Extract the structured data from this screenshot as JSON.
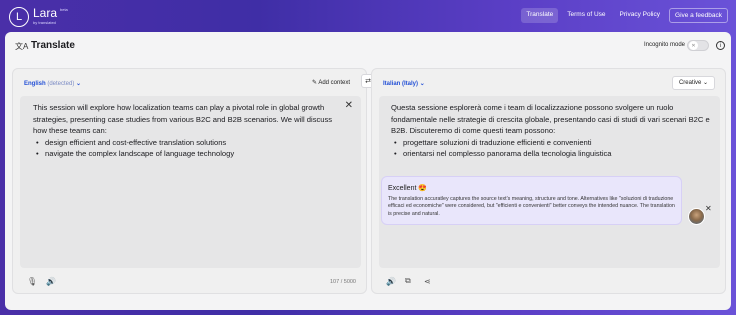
{
  "app": {
    "logo_letter": "L",
    "name": "Lara",
    "beta": "beta",
    "by": "by translated"
  },
  "nav": {
    "translate": "Translate",
    "terms": "Terms of Use",
    "privacy": "Privacy Policy",
    "feedback": "Give a feedback"
  },
  "header": {
    "title": "Translate",
    "incognito_label": "Incognito mode",
    "incognito_enabled": false
  },
  "source": {
    "language": "English",
    "detected": "(detected)",
    "add_context": "Add context",
    "intro": "This session will explore how localization teams can play a pivotal role in global growth strategies, presenting case studies from various B2C and B2B scenarios. We will discuss how these teams can:",
    "bullets": [
      "design efficient and cost-effective translation solutions",
      "navigate the complex landscape of language technology"
    ],
    "char_count": "107 / 5000"
  },
  "target": {
    "language": "Italian (Italy)",
    "style": "Creative",
    "intro": "Questa sessione esplorerà come i team di localizzazione possono svolgere un ruolo fondamentale nelle strategie di crescita globale, presentando casi di studi di vari scenari B2C e B2B. Discuteremo di come questi team possono:",
    "bullets": [
      "progettare soluzioni di traduzione efficienti e convenienti",
      "orientarsi nel complesso panorama della tecnologia linguistica"
    ]
  },
  "quality": {
    "title": "Excellent",
    "emoji": "😍",
    "text": "The translation accuratley captures the source text's meaning, structure and tone. Alternatives like \"soluzioni di traduzione efficaci ed economiche\" were considered, but \"efficienti e convenienti\" better conveys the intended nuance. The translation is precise and natural."
  },
  "colors": {
    "accent": "#2350d6",
    "background_start": "#4a2fa8",
    "background_end": "#6a52d8",
    "quality_bg": "#e9e6fb"
  },
  "icons": [
    "translate-icon",
    "info-icon",
    "chevron-down-icon",
    "add-context-icon",
    "swap-icon",
    "close-icon",
    "microphone-icon",
    "speaker-icon",
    "copy-icon",
    "share-icon"
  ]
}
